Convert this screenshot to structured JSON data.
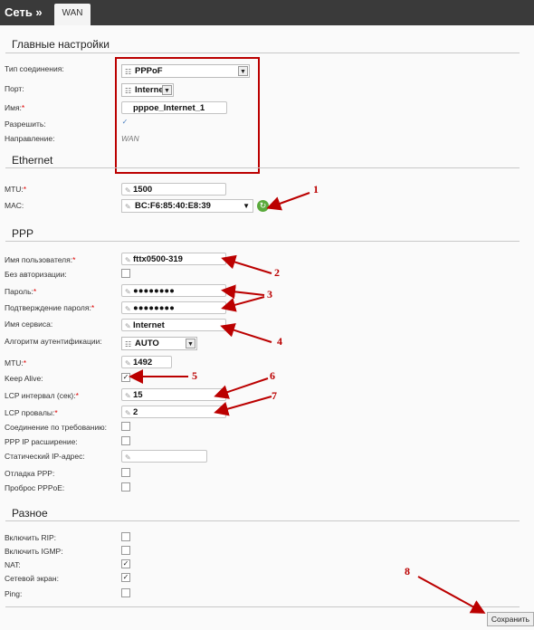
{
  "header": {
    "breadcrumb": "Сеть »",
    "tab": "WAN"
  },
  "main_settings": {
    "title": "Главные настройки",
    "conn_type_label": "Тип соединения:",
    "conn_type_value": "PPPoF",
    "port_label": "Порт:",
    "port_value": "Internet",
    "name_label": "Имя:",
    "name_value": "pppoe_Internet_1",
    "allow_label": "Разрешить:",
    "direction_label": "Направление:",
    "direction_value": "WAN"
  },
  "ethernet": {
    "title": "Ethernet",
    "mtu_label": "MTU:",
    "mtu_value": "1500",
    "mac_label": "MAC:",
    "mac_value": "BC:F6:85:40:E8:39"
  },
  "ppp": {
    "title": "PPP",
    "username_label": "Имя пользователя:",
    "username_value": "fttx0500-319",
    "no_auth_label": "Без авторизации:",
    "password_label": "Пароль:",
    "password_value": "●●●●●●●●",
    "password_confirm_label": "Подтверждение пароля:",
    "password_confirm_value": "●●●●●●●●",
    "service_label": "Имя сервиса:",
    "service_value": "Internet",
    "auth_algo_label": "Алгоритм аутентификации:",
    "auth_algo_value": "AUTO",
    "mtu_label": "MTU:",
    "mtu_value": "1492",
    "keepalive_label": "Keep Alive:",
    "lcp_interval_label": "LCP интервал (сек):",
    "lcp_interval_value": "15",
    "lcp_failures_label": "LCP провалы:",
    "lcp_failures_value": "2",
    "on_demand_label": "Соединение по требованию:",
    "ppp_ip_ext_label": "PPP IP расширение:",
    "static_ip_label": "Статический IP-адрес:",
    "debug_label": "Отладка PPP:",
    "pppoe_passthrough_label": "Проброс PPPoE:"
  },
  "misc": {
    "title": "Разное",
    "rip_label": "Включить RIP:",
    "igmp_label": "Включить IGMP:",
    "nat_label": "NAT:",
    "firewall_label": "Сетевой экран:",
    "ping_label": "Ping:"
  },
  "save_label": "Сохранить",
  "annotations": [
    "1",
    "2",
    "3",
    "4",
    "5",
    "6",
    "7",
    "8"
  ],
  "colors": {
    "topbar": "#3a3a3a",
    "annotation_red": "#b00000",
    "refresh_green": "#5aaa3c"
  },
  "icons": [
    "pencil-icon",
    "list-icon",
    "dropdown-arrow-icon",
    "refresh-icon",
    "checkmark-icon"
  ]
}
